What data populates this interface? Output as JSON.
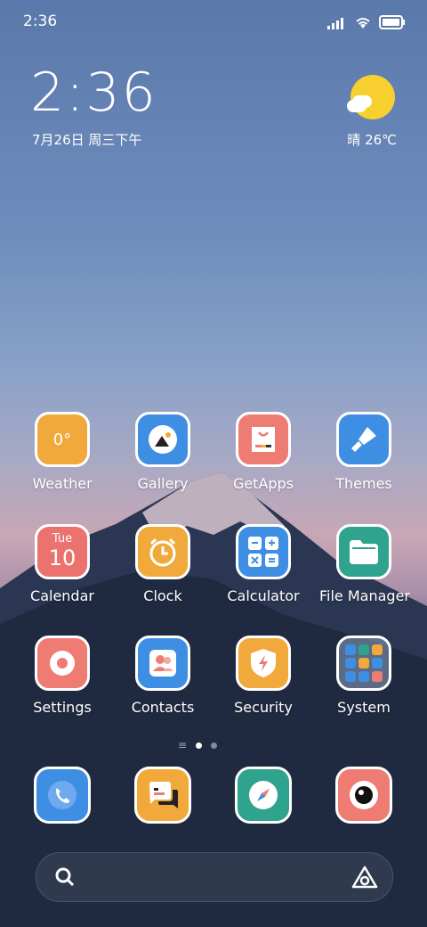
{
  "status": {
    "time": "2:36"
  },
  "lockscreen": {
    "time": "2:36",
    "date": "7月26日 周三下午",
    "weather": "晴 26℃"
  },
  "apps": [
    {
      "label": "Weather",
      "icon": "weather-icon",
      "color": "#f2a93b",
      "text": "0°"
    },
    {
      "label": "Gallery",
      "icon": "gallery-icon",
      "color": "#3e8fe4"
    },
    {
      "label": "GetApps",
      "icon": "getapps-icon",
      "color": "#ef7c72"
    },
    {
      "label": "Themes",
      "icon": "themes-icon",
      "color": "#3e8fe4"
    },
    {
      "label": "Calendar",
      "icon": "calendar-icon",
      "color": "#ec7270",
      "day": "Tue",
      "date": "10"
    },
    {
      "label": "Clock",
      "icon": "clock-icon",
      "color": "#f2a93b"
    },
    {
      "label": "Calculator",
      "icon": "calculator-icon",
      "color": "#3e8fe4"
    },
    {
      "label": "File Manager",
      "icon": "folder-icon",
      "color": "#2fa38e"
    },
    {
      "label": "Settings",
      "icon": "settings-icon",
      "color": "#ef7c72"
    },
    {
      "label": "Contacts",
      "icon": "contacts-icon",
      "color": "#3e8fe4"
    },
    {
      "label": "Security",
      "icon": "security-icon",
      "color": "#f2a93b"
    },
    {
      "label": "System",
      "icon": "folder-system-icon",
      "color": "#6f86a8"
    }
  ],
  "dock": [
    {
      "icon": "phone-icon",
      "color": "#3e8fe4"
    },
    {
      "icon": "messages-icon",
      "color": "#f2a93b"
    },
    {
      "icon": "browser-icon",
      "color": "#2fa38e"
    },
    {
      "icon": "camera-icon",
      "color": "#ef7c72"
    }
  ]
}
